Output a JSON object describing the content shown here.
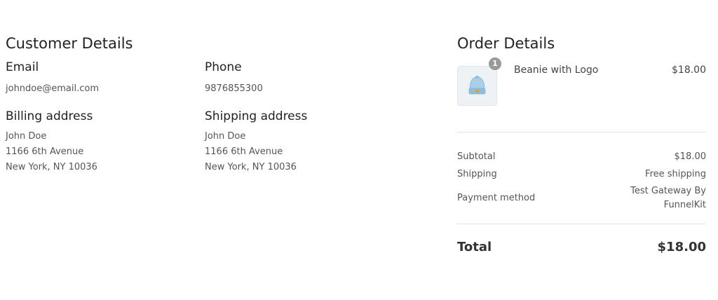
{
  "customer": {
    "title": "Customer Details",
    "email_label": "Email",
    "email": "johndoe@email.com",
    "phone_label": "Phone",
    "phone": "9876855300",
    "billing_label": "Billing address",
    "billing": {
      "name": "John Doe",
      "street": "1166 6th Avenue",
      "city": "New York, NY 10036"
    },
    "shipping_label": "Shipping address",
    "shipping": {
      "name": "John Doe",
      "street": "1166 6th Avenue",
      "city": "New York, NY 10036"
    }
  },
  "order": {
    "title": "Order Details",
    "items": [
      {
        "quantity": "1",
        "name": "Beanie with Logo",
        "price": "$18.00",
        "icon": "beanie-icon"
      }
    ],
    "subtotal_label": "Subtotal",
    "subtotal": "$18.00",
    "shipping_label": "Shipping",
    "shipping": "Free shipping",
    "payment_label": "Payment method",
    "payment": "Test Gateway By FunnelKit",
    "total_label": "Total",
    "total": "$18.00"
  },
  "colors": {
    "thumb_background": "#eef2f5",
    "badge": "#9a9a9a",
    "beanie": "#a9d0e8"
  }
}
